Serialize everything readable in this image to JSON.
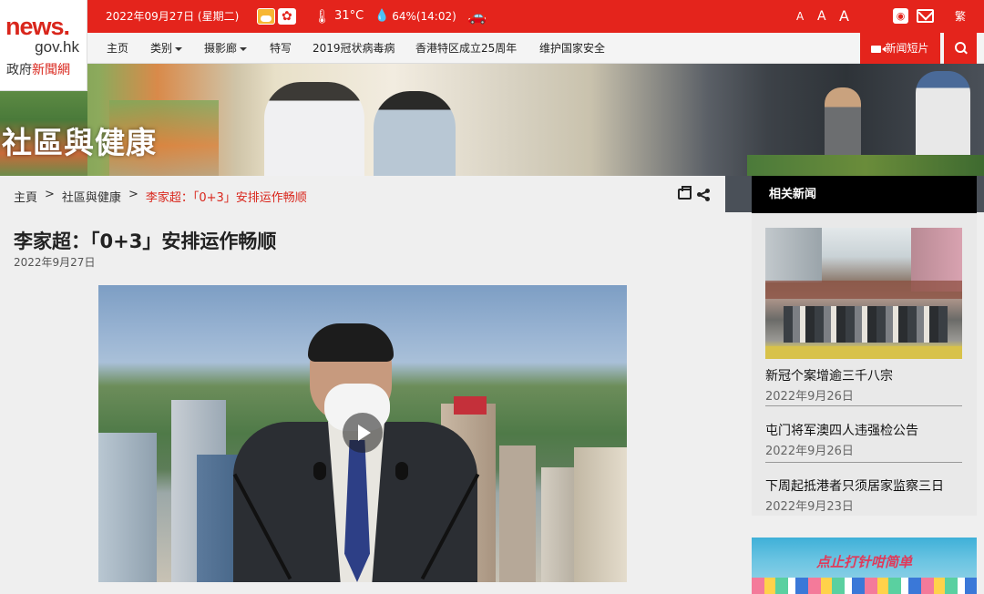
{
  "logo": {
    "line1": "news.",
    "line2": "gov.hk",
    "line3a": "政府",
    "line3b": "新聞網"
  },
  "topbar": {
    "date": "2022年09月27日 (星期二)",
    "temperature": "31°C",
    "humidity": "64%(14:02)",
    "font_small": "A",
    "font_medium": "A",
    "font_large": "A",
    "rss_label": "RSS",
    "lang": "繁"
  },
  "nav": {
    "items": [
      "主页",
      "类别",
      "摄影廊",
      "特写",
      "2019冠状病毒病",
      "香港特区成立25周年",
      "维护国家安全"
    ],
    "video_label": "新闻短片"
  },
  "banner": {
    "title": "社區與健康"
  },
  "breadcrumb": {
    "home": "主頁",
    "sep1": ">",
    "section": "社區與健康",
    "sep2": ">",
    "current": "李家超：「0+3」安排运作畅顺"
  },
  "article": {
    "title": "李家超：「0+3」安排运作畅顺",
    "date": "2022年9月27日"
  },
  "sidebar": {
    "heading": "相关新闻",
    "news": [
      {
        "title": "新冠个案增逾三千八宗",
        "date": "2022年9月26日"
      },
      {
        "title": "屯门将军澳四人违强检公告",
        "date": "2022年9月26日"
      },
      {
        "title": "下周起抵港者只须居家监察三日",
        "date": "2022年9月23日"
      }
    ],
    "ad_text": "点止打针咁简单"
  }
}
